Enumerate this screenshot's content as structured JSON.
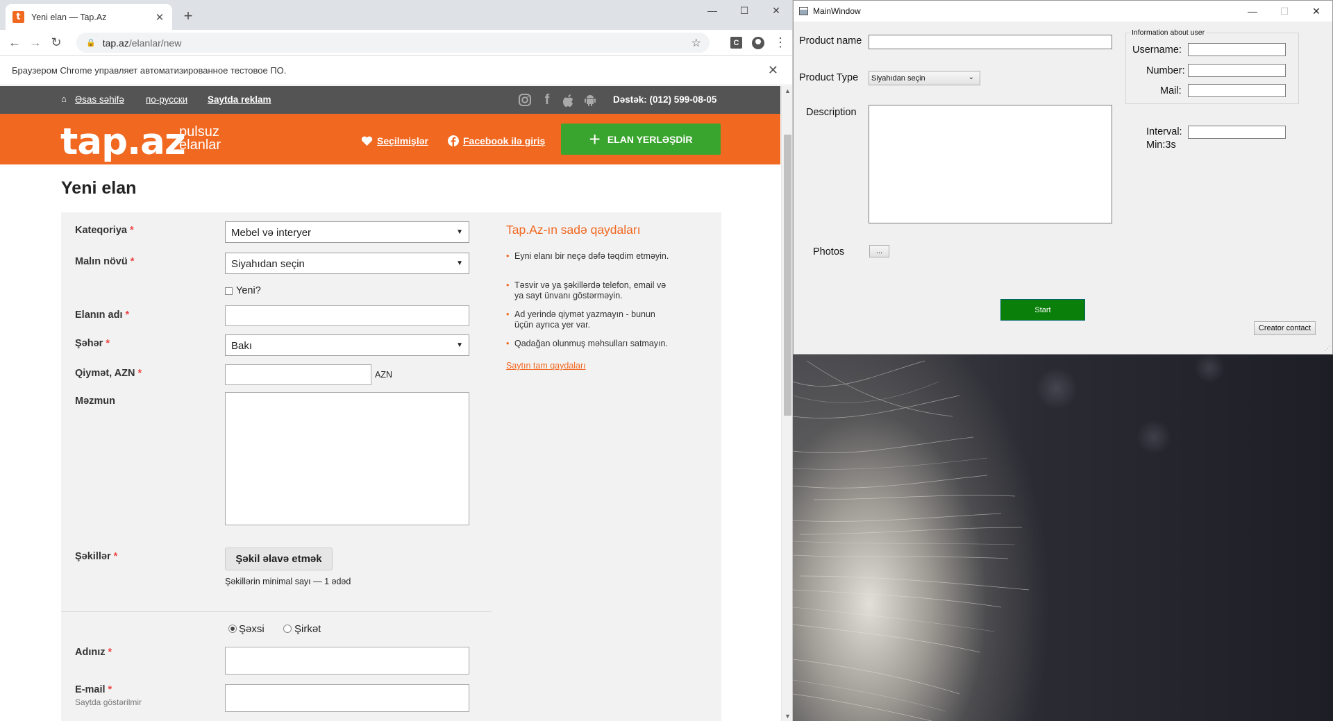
{
  "browser": {
    "tab_title": "Yeni elan — Tap.Az",
    "url_host": "tap.az",
    "url_path": "/elanlar/new",
    "infobar_text": "Браузером Chrome управляет автоматизированное тестовое ПО."
  },
  "site": {
    "top_links": [
      "Əsas səhifə",
      "по-русски",
      "Saytda reklam"
    ],
    "support": "Dəstək: (012) 599-08-05",
    "logo": "tap.az",
    "logo_sub_1": "pulsuz",
    "logo_sub_2": "elanlar",
    "favorites": "Seçilmişlər",
    "facebook_login": "Facebook ilə giriş",
    "post_button": "ELAN YERLƏŞDİR",
    "page_title": "Yeni elan",
    "form": {
      "category_label": "Kateqoriya",
      "category_value": "Mebel və interyer",
      "type_label": "Malın növü",
      "type_value": "Siyahıdan seçin",
      "new_label": "Yeni?",
      "name_label": "Elanın adı",
      "city_label": "Şəhər",
      "city_value": "Bakı",
      "price_label": "Qiymət, AZN",
      "price_unit": "AZN",
      "content_label": "Məzmun",
      "photos_label": "Şəkillər",
      "add_photo_button": "Şəkil əlavə etmək",
      "photos_hint": "Şəkillərin minimal sayı — 1 ədəd",
      "personal_label": "Şəxsi",
      "company_label": "Şirkət",
      "your_name_label": "Adınız",
      "email_label": "E-mail",
      "email_hint": "Saytda göstərilmir"
    },
    "rules": {
      "title": "Tap.Az-ın sadə qaydaları",
      "items": [
        "Eyni elanı bir neçə dəfə təqdim etməyin.",
        "Təsvir və ya şəkillərdə telefon, email və ya sayt ünvanı göstərməyin.",
        "Ad yerində qiymət yazmayın - bunun üçün ayrıca yer var.",
        "Qadağan olunmuş məhsulları satmayın."
      ],
      "link": "Saytın tam qaydaları"
    }
  },
  "qt": {
    "window_title": "MainWindow",
    "product_name_label": "Product name",
    "product_type_label": "Product Type",
    "product_type_value": "Siyahıdan seçin",
    "description_label": "Description",
    "photos_label": "Photos",
    "browse_button": "...",
    "start_button": "Start",
    "creator_button": "Creator contact",
    "group_title": "Information about user",
    "username_label": "Username:",
    "number_label": "Number:",
    "mail_label": "Mail:",
    "interval_label": "Interval:",
    "interval_min": "Min:3s"
  },
  "colors": {
    "brand_orange": "#f16820",
    "green_button": "#3aa52e",
    "qt_start_green": "#0a7f0a"
  }
}
